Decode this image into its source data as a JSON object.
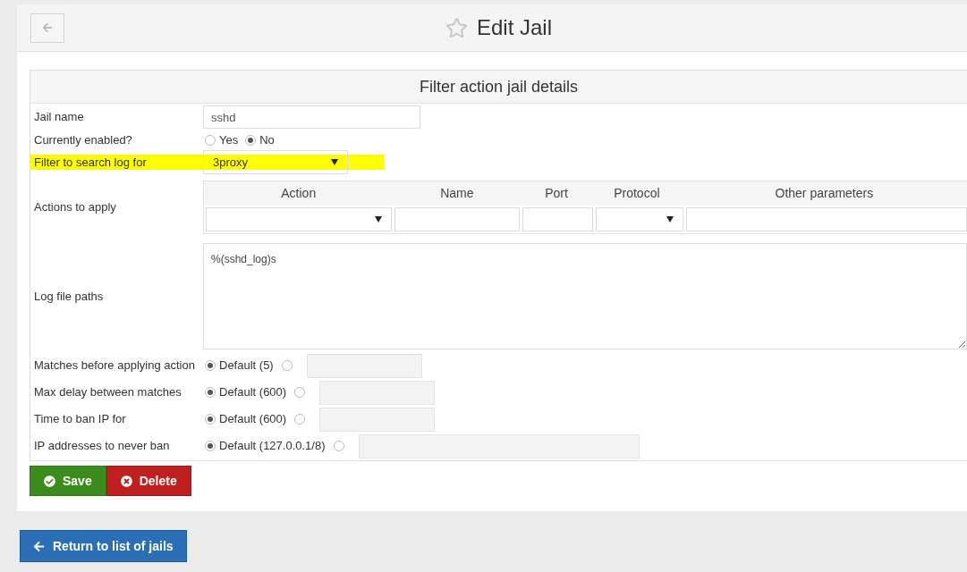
{
  "header": {
    "title": "Edit Jail"
  },
  "section": {
    "title": "Filter action jail details"
  },
  "fields": [
    {
      "kind": "text",
      "label": "Jail name",
      "value": "sshd",
      "highlighted": false
    },
    {
      "kind": "radio",
      "label": "Currently enabled?",
      "options": [
        {
          "label": "Yes",
          "selected": false
        },
        {
          "label": "No",
          "selected": true
        }
      ],
      "highlighted": false
    },
    {
      "kind": "select",
      "label": "Filter to search log for",
      "value": "3proxy",
      "highlighted": true
    },
    {
      "kind": "table",
      "label": "Actions to apply",
      "columns": [
        {
          "label": "Action",
          "kind": "select"
        },
        {
          "label": "Name",
          "kind": "text"
        },
        {
          "label": "Port",
          "kind": "text"
        },
        {
          "label": "Protocol",
          "kind": "select"
        },
        {
          "label": "Other parameters",
          "kind": "text"
        }
      ],
      "highlighted": false
    },
    {
      "kind": "textarea",
      "label": "Log file paths",
      "value": "%(sshd_log)s",
      "highlighted": false
    },
    {
      "kind": "default",
      "label": "Matches before applying action",
      "options": [
        {
          "label": "Default (5)",
          "selected": true
        },
        {
          "selected": false
        }
      ],
      "highlighted": false
    },
    {
      "kind": "default",
      "label": "Max delay between matches",
      "options": [
        {
          "label": "Default (600)",
          "selected": true
        },
        {
          "selected": false
        }
      ],
      "highlighted": false
    },
    {
      "kind": "default",
      "label": "Time to ban IP for",
      "options": [
        {
          "label": "Default (600)",
          "selected": true
        },
        {
          "selected": false
        }
      ],
      "highlighted": false
    },
    {
      "kind": "list",
      "label": "IP addresses to never ban",
      "options": [
        {
          "label": "Default (127.0.0.1/8)",
          "selected": true
        },
        {
          "selected": false
        }
      ],
      "highlighted": false
    }
  ],
  "buttons": [
    {
      "kind": "save",
      "label": "Save"
    },
    {
      "kind": "delete",
      "label": "Delete"
    }
  ],
  "return_button": {
    "label": "Return to list of jails"
  }
}
